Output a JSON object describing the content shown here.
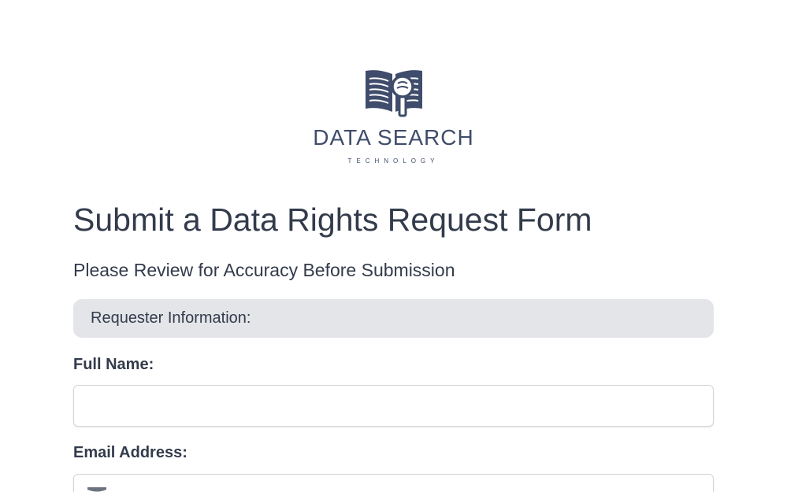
{
  "logo": {
    "name": "DATA SEARCH",
    "tagline": "TECHNOLOGY",
    "color": "#3f4c6b"
  },
  "form": {
    "title": "Submit a Data Rights Request Form",
    "subtitle": "Please Review for Accuracy Before Submission",
    "section_heading": "Requester Information:",
    "fields": [
      {
        "label": "Full Name:",
        "value": "",
        "placeholder": ""
      },
      {
        "label": "Email Address:",
        "value": "",
        "placeholder": "",
        "icon": "envelope-icon"
      }
    ]
  },
  "colors": {
    "text": "#333b4b",
    "section_bar": "#e4e5e9",
    "input_border": "#d4d6db"
  }
}
